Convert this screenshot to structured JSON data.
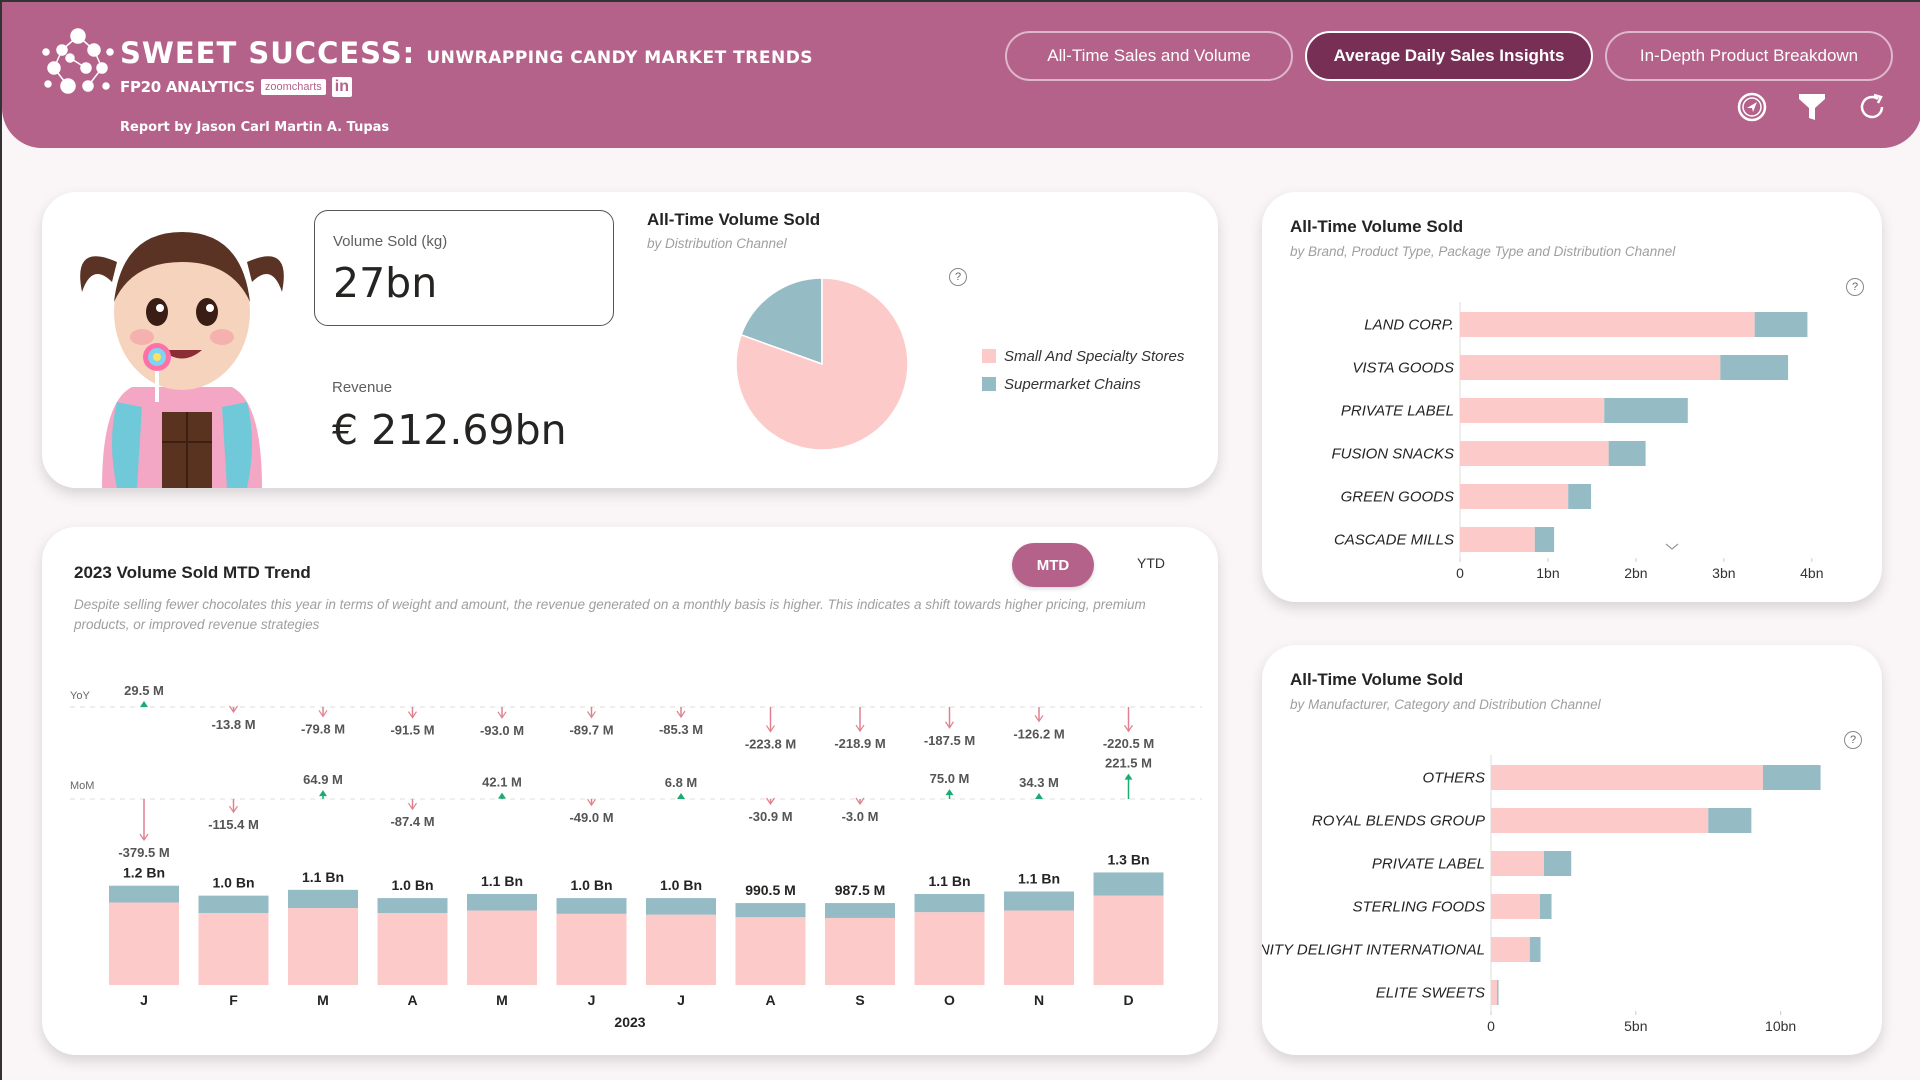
{
  "header": {
    "title_main": "SWEET SUCCESS:",
    "title_sub": "UNWRAPPING CANDY MARKET TRENDS",
    "brand": "FP20 ANALYTICS",
    "partner_badge": "zoomcharts",
    "linkedin_badge": "in",
    "author": "Report by Jason Carl Martin A. Tupas",
    "nav": [
      {
        "label": "All-Time Sales and Volume",
        "active": false
      },
      {
        "label": "Average Daily Sales Insights",
        "active": true
      },
      {
        "label": "In-Depth Product Breakdown",
        "active": false
      }
    ],
    "tools": [
      "navigate-icon",
      "filter-icon",
      "refresh-icon"
    ]
  },
  "kpi": {
    "volume_label": "Volume Sold (kg)",
    "volume_value": "27bn",
    "revenue_label": "Revenue",
    "revenue_value": "€ 212.69bn"
  },
  "colors": {
    "accent": "#b5628b",
    "accent_dark": "#772f55",
    "small_specialty": "#fdcaca",
    "supermarket": "#95bcc5",
    "positive": "#1aab72",
    "negative": "#e0808f"
  },
  "chart_data": [
    {
      "id": "pie-distribution",
      "type": "pie",
      "title": "All-Time Volume Sold",
      "subtitle": "by Distribution Channel",
      "help": "?",
      "slices": [
        {
          "label": "Small And Specialty Stores",
          "value": 80.5
        },
        {
          "label": "Supermarket Chains",
          "value": 19.5
        }
      ],
      "legend": "right"
    },
    {
      "id": "bar-brand",
      "type": "bar",
      "orientation": "horizontal",
      "stacked": true,
      "title": "All-Time Volume Sold",
      "subtitle": "by Brand, Product Type, Package Type and Distribution Channel",
      "help": "?",
      "categories": [
        "LAND CORP.",
        "VISTA GOODS",
        "PRIVATE LABEL",
        "FUSION SNACKS",
        "GREEN GOODS",
        "CASCADE MILLS"
      ],
      "series": [
        {
          "name": "Small And Specialty Stores",
          "values": [
            3.35,
            2.96,
            1.64,
            1.69,
            1.23,
            0.85
          ]
        },
        {
          "name": "Supermarket Chains",
          "values": [
            0.6,
            0.77,
            0.95,
            0.42,
            0.26,
            0.22
          ]
        }
      ],
      "xlim": [
        0,
        4.4
      ],
      "xticks": [
        "0",
        "1bn",
        "2bn",
        "3bn",
        "4bn"
      ],
      "xtick_values": [
        0,
        1,
        2,
        3,
        4
      ],
      "unit": "bn"
    },
    {
      "id": "bar-manufacturer",
      "type": "bar",
      "orientation": "horizontal",
      "stacked": true,
      "title": "All-Time Volume Sold",
      "subtitle": "by Manufacturer, Category and Distribution Channel",
      "help": "?",
      "categories": [
        "OTHERS",
        "ROYAL BLENDS GROUP",
        "PRIVATE LABEL",
        "STERLING FOODS",
        "UNITY DELIGHT INTERNATIONAL",
        "ELITE SWEETS"
      ],
      "series": [
        {
          "name": "Small And Specialty Stores",
          "values": [
            9.39,
            7.5,
            1.83,
            1.69,
            1.34,
            0.21
          ]
        },
        {
          "name": "Supermarket Chains",
          "values": [
            1.99,
            1.49,
            0.94,
            0.4,
            0.37,
            0.05
          ]
        }
      ],
      "xlim": [
        0,
        13.5
      ],
      "xticks": [
        "0",
        "5bn",
        "10bn"
      ],
      "xtick_values": [
        0,
        5,
        10
      ],
      "unit": "bn"
    },
    {
      "id": "mtd-trend",
      "type": "bar",
      "stacked": true,
      "title": "2023 Volume Sold MTD Trend",
      "subtitle": "Despite selling fewer chocolates this year in terms of weight and amount, the revenue generated on a monthly basis is higher. This indicates a shift towards higher pricing, premium products, or improved revenue strategies",
      "toggle": {
        "options": [
          "MTD",
          "YTD"
        ],
        "selected": "MTD"
      },
      "xlabel": "2023",
      "categories": [
        "J",
        "F",
        "M",
        "A",
        "M",
        "J",
        "J",
        "A",
        "S",
        "O",
        "N",
        "D"
      ],
      "series": [
        {
          "name": "Small And Specialty Stores",
          "values": [
            0.996,
            0.87,
            0.93,
            0.87,
            0.9,
            0.86,
            0.85,
            0.82,
            0.81,
            0.88,
            0.9,
            1.08
          ]
        },
        {
          "name": "Supermarket Chains",
          "values": [
            0.204,
            0.21,
            0.22,
            0.18,
            0.2,
            0.19,
            0.2,
            0.17,
            0.18,
            0.22,
            0.23,
            0.28
          ]
        }
      ],
      "total_labels": [
        "1.2 Bn",
        "1.0 Bn",
        "1.1 Bn",
        "1.0 Bn",
        "1.1 Bn",
        "1.0 Bn",
        "1.0 Bn",
        "990.5 M",
        "987.5 M",
        "1.1 Bn",
        "1.1 Bn",
        "1.3 Bn"
      ],
      "ylim": [
        0,
        1.45
      ],
      "variance_rows": [
        {
          "label": "YoY",
          "values": [
            29.5,
            -13.8,
            -79.8,
            -91.5,
            -93.0,
            -89.7,
            -85.3,
            -223.8,
            -218.9,
            -187.5,
            -126.2,
            -220.5
          ],
          "labels": [
            "29.5 M",
            "-13.8 M",
            "-79.8 M",
            "-91.5 M",
            "-93.0 M",
            "-89.7 M",
            "-85.3 M",
            "-223.8 M",
            "-218.9 M",
            "-187.5 M",
            "-126.2 M",
            "-220.5 M"
          ]
        },
        {
          "label": "MoM",
          "values": [
            -379.5,
            -115.4,
            64.9,
            -87.4,
            42.1,
            -49.0,
            6.8,
            -30.9,
            -3.0,
            75.0,
            34.3,
            221.5
          ],
          "labels": [
            "-379.5 M",
            "-115.4 M",
            "64.9 M",
            "-87.4 M",
            "42.1 M",
            "-49.0 M",
            "6.8 M",
            "-30.9 M",
            "-3.0 M",
            "75.0 M",
            "34.3 M",
            "221.5 M"
          ]
        }
      ]
    }
  ]
}
